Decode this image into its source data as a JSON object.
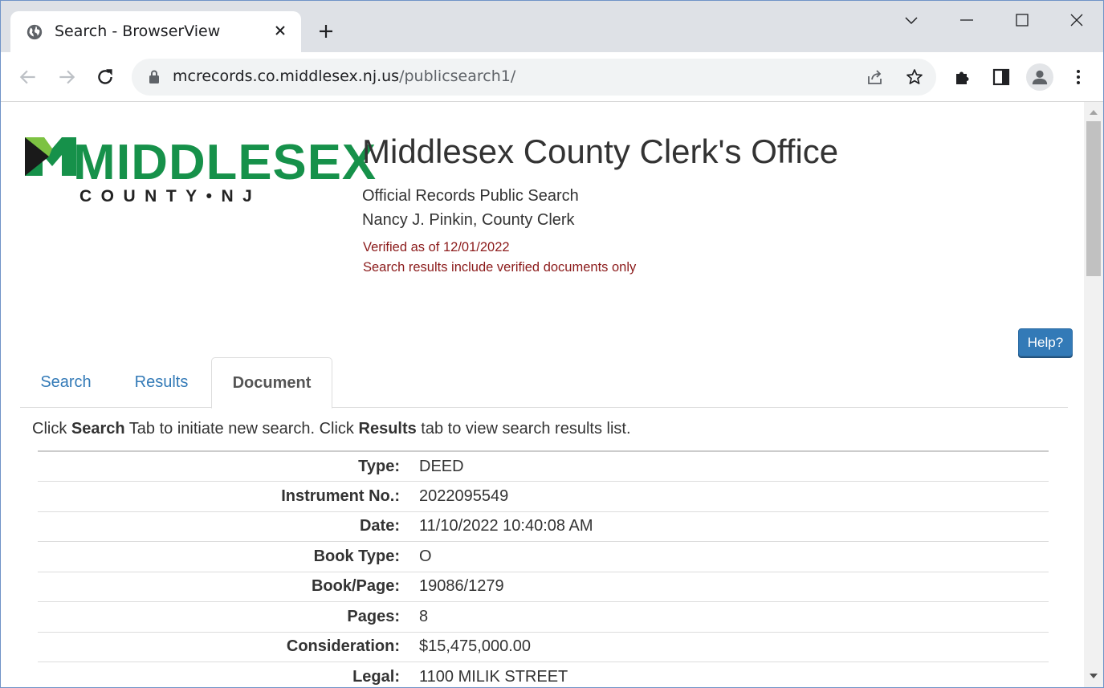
{
  "browser": {
    "tab_title": "Search - BrowserView",
    "url_host": "mcrecords.co.middlesex.nj.us",
    "url_path": "/publicsearch1/"
  },
  "logo": {
    "wordmark": "MIDDLESEX",
    "subtitle": "COUNTY•NJ",
    "brand_color": "#16914a"
  },
  "header": {
    "title": "Middlesex County Clerk's Office",
    "subtitle": "Official Records Public Search",
    "clerk": "Nancy J. Pinkin, County Clerk",
    "verified": "Verified as of 12/01/2022",
    "verified_note": "Search results include verified documents only"
  },
  "help_label": "Help?",
  "tabs": [
    {
      "label": "Search",
      "active": false
    },
    {
      "label": "Results",
      "active": false
    },
    {
      "label": "Document",
      "active": true
    }
  ],
  "instructions": {
    "p1": "Click ",
    "b1": "Search",
    "p2": " Tab to initiate new search. Click ",
    "b2": "Results",
    "p3": " tab to view search results list."
  },
  "document": [
    {
      "label": "Type:",
      "value": "DEED"
    },
    {
      "label": "Instrument No.:",
      "value": "2022095549"
    },
    {
      "label": "Date:",
      "value": "11/10/2022 10:40:08 AM"
    },
    {
      "label": "Book Type:",
      "value": "O"
    },
    {
      "label": "Book/Page:",
      "value": "19086/1279"
    },
    {
      "label": "Pages:",
      "value": "8"
    },
    {
      "label": "Consideration:",
      "value": "$15,475,000.00"
    },
    {
      "label": "Legal:",
      "value": "1100 MILIK STREET"
    }
  ],
  "colors": {
    "link": "#337ab7",
    "verified_text": "#8b1a1a",
    "button": "#337ab7"
  }
}
